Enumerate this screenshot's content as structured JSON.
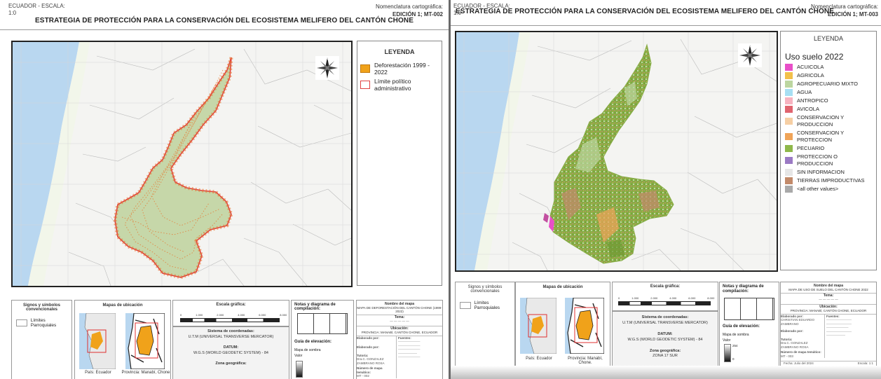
{
  "left_sheet": {
    "header": {
      "scale_label": "ECUADOR - ESCALA:",
      "scale_value": "1:0",
      "title": "ESTRATEGIA DE PROTECCIÓN PARA LA CONSERVACIÓN DEL ECOSISTEMA MELIFERO DEL CANTÓN CHONE",
      "nomenclature_label": "Nomenclatura cartográfica:",
      "edition": "EDICIÓN 1; MT-002"
    },
    "legend": {
      "title": "LEYENDA",
      "items": [
        {
          "label": "Deforestación 1999 - 2022",
          "color": "#f0a21a"
        },
        {
          "label": "Límite político administrativo",
          "color": "#e04040"
        }
      ]
    },
    "signs_box": {
      "title": "Signos y símbolos convencionales",
      "item": "Límites Parroquiales"
    },
    "location_box": {
      "title": "Mapas de ubicación",
      "caption_1": "País: Ecuador",
      "caption_2": "Provincia: Manabí, Chone"
    },
    "scale_box": {
      "title": "Escala gráfica:",
      "ticks": [
        "0",
        "1.000",
        "2.000",
        "4.000",
        "6.000",
        "8.000"
      ]
    },
    "coords_box": {
      "title": "Sistema de coordenadas:",
      "system": "U.T.M (UNIVERSAL TRANSVERSE MERCATOR)",
      "datum_title": "DATUM:",
      "datum": "W.G.S (WORLD GEODETIC SYSTEM) - 84",
      "zone_title": "Zona geográfica:"
    },
    "notes_box": {
      "title": "Notas y diagrama de compilación:",
      "elevation_title": "Guía de elevación:",
      "shade_title": "Mapa de sombra",
      "value_label": "Valor"
    },
    "info_box": {
      "name_title": "Nombre del mapa",
      "map_name": "MAPA DE DEFORESTACIÓN DEL CANTÓN CHONE (1999-2022)",
      "theme_title": "Tema:",
      "location_title": "Ubicación:",
      "location": "PROVINCIA: MANABÍ, CANTÓN CHONE, ECUADOR",
      "made_by": "Elaborado por:",
      "reviewed_by": "Elaborado por:",
      "tutor": "Tutoría:",
      "tutor_name": "Dra.C. GONZALEZ ZAMBRANO ROSA",
      "sources_title": "Fuentes:",
      "sheet_no": "Número de mapa temático:",
      "sheet_code": "MT - 002"
    }
  },
  "right_sheet": {
    "header": {
      "scale_label": "ECUADOR - ESCALA:",
      "scale_value": "1:0",
      "title": "ESTRATEGIA DE PROTECCIÓN PARA LA CONSERVACIÓN DEL ECOSISTEMA MELIFERO DEL CANTÓN CHONE",
      "nomenclature_label": "Nomenclatura cartográfica:",
      "edition": "EDICIÓN 1; MT-003"
    },
    "legend": {
      "title": "LEYENDA",
      "subtitle": "Uso suelo 2022",
      "items": [
        {
          "label": "ACUICOLA",
          "color": "#e84fc8"
        },
        {
          "label": "AGRICOLA",
          "color": "#f2c04a"
        },
        {
          "label": "AGROPECUARIO MIXTO",
          "color": "#bcd6a0"
        },
        {
          "label": "AGUA",
          "color": "#a7dff3"
        },
        {
          "label": "ANTROPICO",
          "color": "#f7b3c0"
        },
        {
          "label": "AVICOLA",
          "color": "#e0646f"
        },
        {
          "label": "CONSERVACION Y PRODUCCION",
          "color": "#f6cfa4"
        },
        {
          "label": "CONSERVACION Y PROTECCION",
          "color": "#f0a458"
        },
        {
          "label": "PECUARIO",
          "color": "#8fb84a"
        },
        {
          "label": "PROTECCION O PRODUCCION",
          "color": "#9b7ac4"
        },
        {
          "label": "SIN INFORMACION",
          "color": "#e6e6e6"
        },
        {
          "label": "TIERRAS IMPRODUCTIVAS",
          "color": "#c28a6a"
        },
        {
          "label": "<all other values>",
          "color": "#a9a9a9"
        }
      ]
    },
    "signs_box": {
      "title": "Signos y símbolos convencionales",
      "item": "Límites Parroquiales"
    },
    "location_box": {
      "title": "Mapas de ubicación",
      "caption_1": "País: Ecuador",
      "caption_2": "Provincia: Manabí, Chone."
    },
    "scale_box": {
      "title": "Escala gráfica:",
      "ticks": [
        "0",
        "1.000",
        "2.000",
        "4.000",
        "6.000",
        "8.000"
      ]
    },
    "coords_box": {
      "title": "Sistema de coordenadas:",
      "system": "U.T.M (UNIVERSAL TRANSVERSE MERCATOR)",
      "datum_title": "DATUM:",
      "datum": "W.G.S (WORLD GEODETIC SYSTEM) - 84",
      "zone_title": "Zona geográfica:",
      "zone": "ZONA 17 SUR"
    },
    "notes_box": {
      "title": "Notas y diagrama de compilación:",
      "elevation_title": "Guía de elevación:",
      "shade_title": "Mapa de sombra",
      "value_label": "Valor",
      "value_max": "254",
      "value_min": "0"
    },
    "info_box": {
      "name_title": "Nombre del mapa",
      "map_name": "MAPA DE USO DE SUELO DEL CANTÓN CHONE 2022",
      "theme_title": "Tema:",
      "location_title": "Ubicación:",
      "location": "PROVINCIA: MANABÍ, CANTÓN CHONE, ECUADOR",
      "made_by": "Elaborado por:",
      "author": "CHRISTIAN EDUARDO ZAMBRANO",
      "reviewed_by": "Elaborado por:",
      "tutor": "Tutoría:",
      "tutor_name": "Dra.C. GONZALEZ ZAMBRANO ROSA",
      "sources_title": "Fuentes:",
      "sheet_no": "Número de mapa temático:",
      "sheet_code": "MT - 003",
      "date": "Fecha: Julio del 2024",
      "scale": "Escala: 1:1"
    }
  },
  "colors": {
    "sea": "#b9d7f0",
    "coast": "#f2f6ea",
    "land": "#f3f3f3",
    "canton_left": "#c6d7a9",
    "deforest": "#e8722a",
    "boundary": "#e04040",
    "green": "#86ad45"
  }
}
